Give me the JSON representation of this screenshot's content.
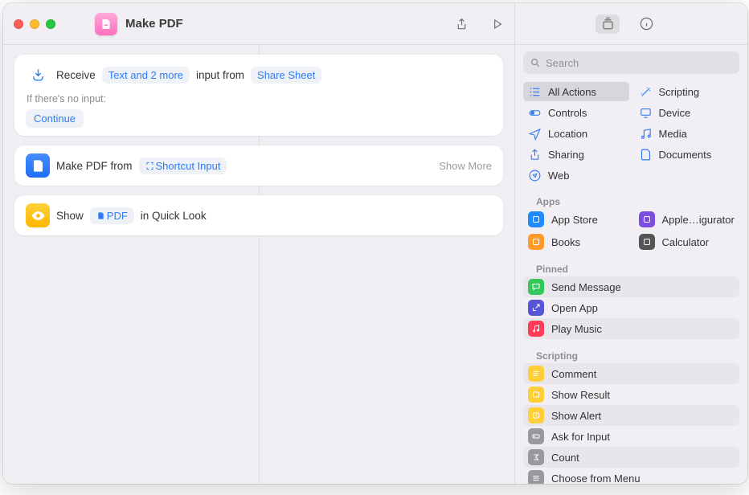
{
  "window": {
    "title": "Make PDF"
  },
  "editor": {
    "card1": {
      "receive_label": "Receive",
      "input_type": "Text and 2 more",
      "from_label": "input from",
      "source": "Share Sheet",
      "no_input_label": "If there's no input:",
      "continue_label": "Continue"
    },
    "card2": {
      "action_label": "Make PDF from",
      "param": "Shortcut Input",
      "show_more": "Show More"
    },
    "card3": {
      "show_label": "Show",
      "param": "PDF",
      "tail": "in Quick Look"
    }
  },
  "sidebar": {
    "search_placeholder": "Search",
    "categories": [
      {
        "label": "All Actions",
        "icon": "list",
        "selected": true
      },
      {
        "label": "Scripting",
        "icon": "wand"
      },
      {
        "label": "Controls",
        "icon": "toggle"
      },
      {
        "label": "Device",
        "icon": "device"
      },
      {
        "label": "Location",
        "icon": "nav"
      },
      {
        "label": "Media",
        "icon": "music"
      },
      {
        "label": "Sharing",
        "icon": "share"
      },
      {
        "label": "Documents",
        "icon": "doc"
      },
      {
        "label": "Web",
        "icon": "compass"
      }
    ],
    "apps_header": "Apps",
    "apps": [
      {
        "label": "App Store",
        "color": "#1f8bff"
      },
      {
        "label": "Apple…igurator",
        "color": "#7d4ce0"
      },
      {
        "label": "Books",
        "color": "#ff9a2b"
      },
      {
        "label": "Calculator",
        "color": "#555"
      }
    ],
    "pinned_header": "Pinned",
    "pinned": [
      {
        "label": "Send Message",
        "color": "#34c759",
        "icon": "bubble"
      },
      {
        "label": "Open App",
        "color": "#5856d6",
        "icon": "open"
      },
      {
        "label": "Play Music",
        "color": "#ff3b57",
        "icon": "music"
      }
    ],
    "scripting_header": "Scripting",
    "scripting": [
      {
        "label": "Comment",
        "color": "#ffcf3a",
        "icon": "lines"
      },
      {
        "label": "Show Result",
        "color": "#ffcf3a",
        "icon": "box"
      },
      {
        "label": "Show Alert",
        "color": "#ffcf3a",
        "icon": "alert"
      },
      {
        "label": "Ask for Input",
        "color": "#98989d",
        "icon": "input"
      },
      {
        "label": "Count",
        "color": "#98989d",
        "icon": "sigma"
      },
      {
        "label": "Choose from Menu",
        "color": "#98989d",
        "icon": "menu"
      }
    ]
  }
}
